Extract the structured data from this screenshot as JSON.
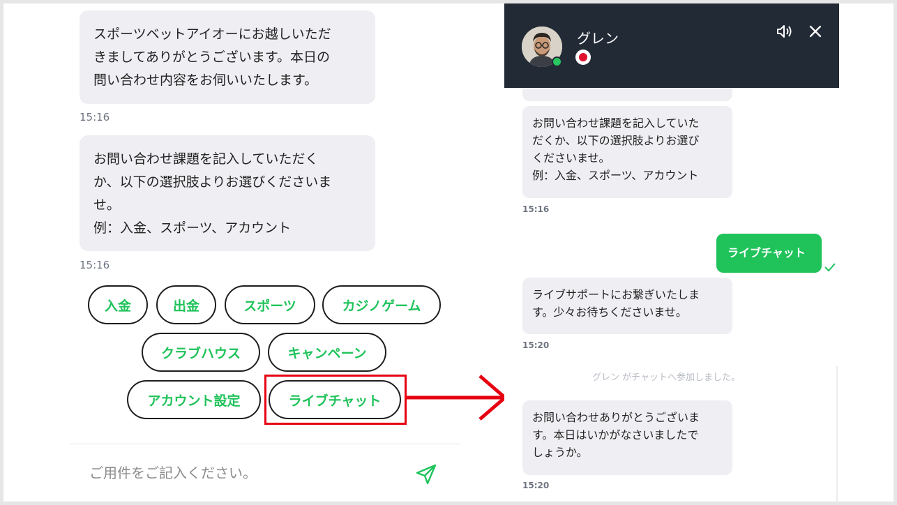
{
  "left": {
    "messages": [
      {
        "text": "スポーツベットアイオーにお越しいただ\nきましてありがとうございます。本日の\n問い合わせ内容をお伺いいたします。",
        "time": "15:16"
      },
      {
        "text": "お問い合わせ課題を記入していただく\nか、以下の選択肢よりお選びくださいま\nせ。\n例：入金、スポーツ、アカウント",
        "time": "15:16"
      }
    ],
    "quick_replies": [
      "入金",
      "出金",
      "スポーツ",
      "カジノゲーム",
      "クラブハウス",
      "キャンペーン",
      "アカウント設定",
      "ライブチャット"
    ],
    "composer": {
      "placeholder": "ご用件をご記入ください。"
    }
  },
  "right": {
    "header": {
      "agent_name": "グレン"
    },
    "messages": [
      {
        "text": "お問い合わせ課題を記入していた\nだくか、以下の選択肢よりお選び\nくださいませ。\n例：入金、スポーツ、アカウント",
        "time": "15:16"
      },
      {
        "sent_text": "ライブチャット"
      },
      {
        "text": "ライブサポートにお繋ぎいたしま\nす。少々お待ちくださいませ。",
        "time": "15:20"
      },
      {
        "system": "グレン がチャットへ参加しました。"
      },
      {
        "text": "お問い合わせありがとうございま\nす。本日はいかがなさいましたで\nしょうか。",
        "time": "15:20"
      }
    ]
  },
  "colors": {
    "accent_green": "#1fc35a",
    "highlight_red": "#e60012",
    "header_dark": "#222a35",
    "bubble_gray": "#efeff3"
  }
}
